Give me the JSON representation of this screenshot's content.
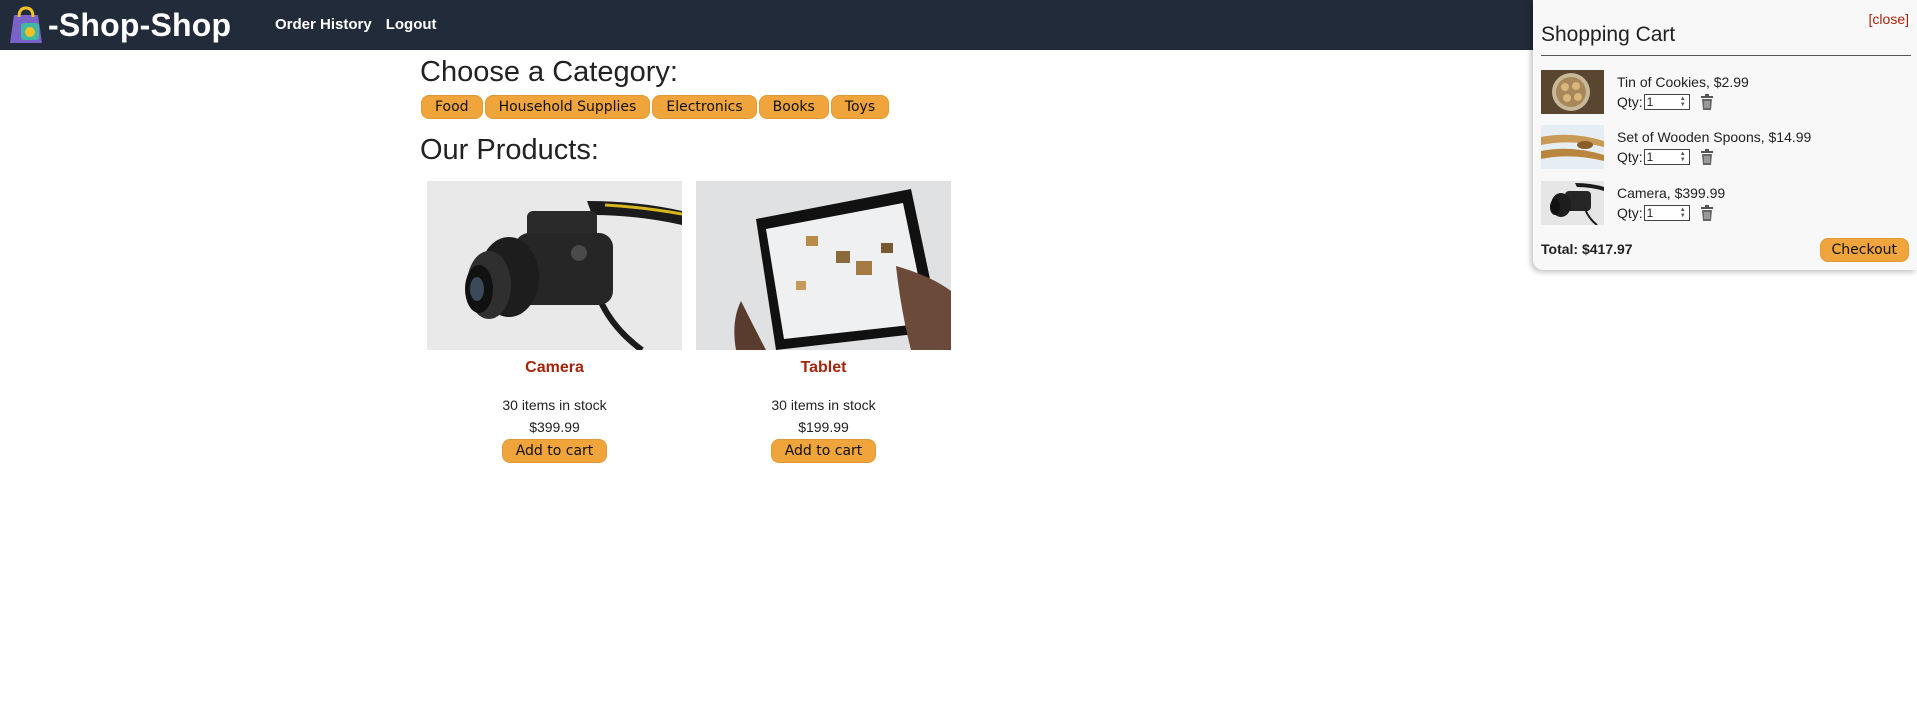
{
  "header": {
    "app_name": "-Shop-Shop",
    "nav": [
      {
        "label": "Order History"
      },
      {
        "label": "Logout"
      }
    ]
  },
  "categories": {
    "title": "Choose a Category:",
    "items": [
      "Food",
      "Household Supplies",
      "Electronics",
      "Books",
      "Toys"
    ]
  },
  "products": {
    "title": "Our Products:",
    "items": [
      {
        "name": "Camera",
        "stock": "30 items in stock",
        "price": "$399.99",
        "button": "Add to cart",
        "image": "camera-photo"
      },
      {
        "name": "Tablet",
        "stock": "30 items in stock",
        "price": "$199.99",
        "button": "Add to cart",
        "image": "tablet-photo"
      }
    ]
  },
  "cart": {
    "close_label": "[close]",
    "title": "Shopping Cart",
    "qty_label": "Qty:",
    "items": [
      {
        "desc": "Tin of Cookies, $2.99",
        "qty": "1",
        "image": "cookies-photo"
      },
      {
        "desc": "Set of Wooden Spoons, $14.99",
        "qty": "1",
        "image": "spoons-photo"
      },
      {
        "desc": "Camera, $399.99",
        "qty": "1",
        "image": "camera-photo"
      }
    ],
    "total": "Total: $417.97",
    "checkout_label": "Checkout"
  },
  "colors": {
    "navbar": "#222b3a",
    "accent_button": "#f0a43c",
    "product_name": "#a5240a"
  }
}
